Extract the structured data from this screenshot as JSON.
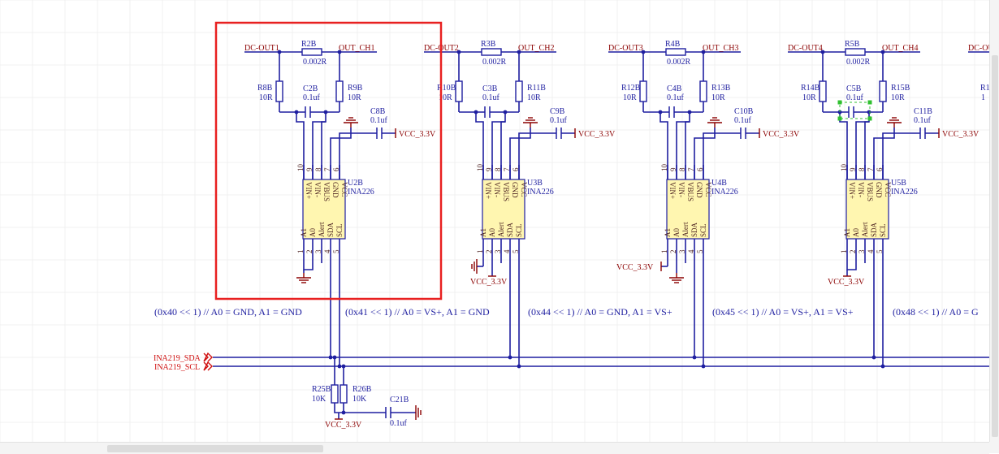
{
  "schematic": {
    "channels": [
      {
        "id": "ch1",
        "net_in": "DC-OUT1",
        "net_out": "OUT_CH1",
        "shunt": {
          "ref": "R2B",
          "value": "0.002R"
        },
        "r_left": {
          "ref": "R8B",
          "value": "10R"
        },
        "r_right": {
          "ref": "R9B",
          "value": "10R"
        },
        "c_filter": {
          "ref": "C2B",
          "value": "0.1uf"
        },
        "c_decouple": {
          "ref": "C8B",
          "value": "0.1uf"
        },
        "vcc_net": "VCC_3.3V",
        "ic": {
          "ref": "U2B",
          "part": "INA226"
        },
        "addr_comment": "(0x40 << 1)     // A0 = GND, A1 = GND",
        "a_strap": "gnd"
      },
      {
        "id": "ch2",
        "net_in": "DC-OUT2",
        "net_out": "OUT_CH2",
        "shunt": {
          "ref": "R3B",
          "value": "0.002R"
        },
        "r_left": {
          "ref": "R10B",
          "value": "10R"
        },
        "r_right": {
          "ref": "R11B",
          "value": "10R"
        },
        "c_filter": {
          "ref": "C3B",
          "value": "0.1uf"
        },
        "c_decouple": {
          "ref": "C9B",
          "value": "0.1uf"
        },
        "vcc_net": "VCC_3.3V",
        "ic": {
          "ref": "U3B",
          "part": "INA226"
        },
        "strap_net": "VCC_3.3V",
        "addr_comment": "(0x41 << 1)     // A0 = VS+, A1 = GND",
        "a_strap": "a0vcc"
      },
      {
        "id": "ch3",
        "net_in": "DC-OUT3",
        "net_out": "OUT_CH3",
        "shunt": {
          "ref": "R4B",
          "value": "0.002R"
        },
        "r_left": {
          "ref": "R12B",
          "value": "10R"
        },
        "r_right": {
          "ref": "R13B",
          "value": "10R"
        },
        "c_filter": {
          "ref": "C4B",
          "value": "0.1uf"
        },
        "c_decouple": {
          "ref": "C10B",
          "value": "0.1uf"
        },
        "vcc_net": "VCC_3.3V",
        "ic": {
          "ref": "U4B",
          "part": "INA226"
        },
        "strap_net": "VCC_3.3V",
        "addr_comment": "(0x44 << 1)     // A0 = GND, A1 = VS+",
        "a_strap": "a1vcc"
      },
      {
        "id": "ch4",
        "net_in": "DC-OUT4",
        "net_out": "OUT_CH4",
        "shunt": {
          "ref": "R5B",
          "value": "0.002R"
        },
        "r_left": {
          "ref": "R14B",
          "value": "10R"
        },
        "r_right": {
          "ref": "R15B",
          "value": "10R"
        },
        "c_filter": {
          "ref": "C5B",
          "value": "0.1uf"
        },
        "c_decouple": {
          "ref": "C11B",
          "value": "0.1uf"
        },
        "vcc_net": "VCC_3.3V",
        "ic": {
          "ref": "U5B",
          "part": "INA226"
        },
        "strap_net": "VCC_3.3V",
        "addr_comment": "(0x45 << 1)     // A0 = VS+, A1 = VS+",
        "a_strap": "bothvcc"
      }
    ],
    "clipped_right": {
      "net_in": "DC-OU",
      "r_fragment": "R1",
      "v_fragment": "1",
      "addr_comment": "(0x48 << 1)     // A0 = G"
    },
    "pins_top": [
      {
        "num": "10",
        "name": "VIN+"
      },
      {
        "num": "9",
        "name": "VIN-"
      },
      {
        "num": "8",
        "name": "VBUS"
      },
      {
        "num": "7",
        "name": "GND"
      },
      {
        "num": "6",
        "name": "VCC"
      }
    ],
    "pins_bottom": [
      {
        "num": "1",
        "name": "A1"
      },
      {
        "num": "2",
        "name": "A0"
      },
      {
        "num": "3",
        "name": "Alert"
      },
      {
        "num": "4",
        "name": "SDA"
      },
      {
        "num": "5",
        "name": "SCL"
      }
    ],
    "bus": {
      "sda_label": "INA219_SDA",
      "scl_label": "INA219_SCL",
      "pullup_sda": {
        "ref": "R25B",
        "value": "10K"
      },
      "pullup_scl": {
        "ref": "R26B",
        "value": "10K"
      },
      "pullup_net": "VCC_3.3V",
      "cap": {
        "ref": "C21B",
        "value": "0.1uf"
      }
    },
    "selection_highlight": "ch1",
    "selected_component": "C5B",
    "colors": {
      "wire": "#1f1fa0",
      "power_net": "#8b0000",
      "bus_port": "#d01010",
      "ic_body": "#fff6b0",
      "selection_box": "#e82020",
      "selection_handle": "#30c030"
    }
  }
}
